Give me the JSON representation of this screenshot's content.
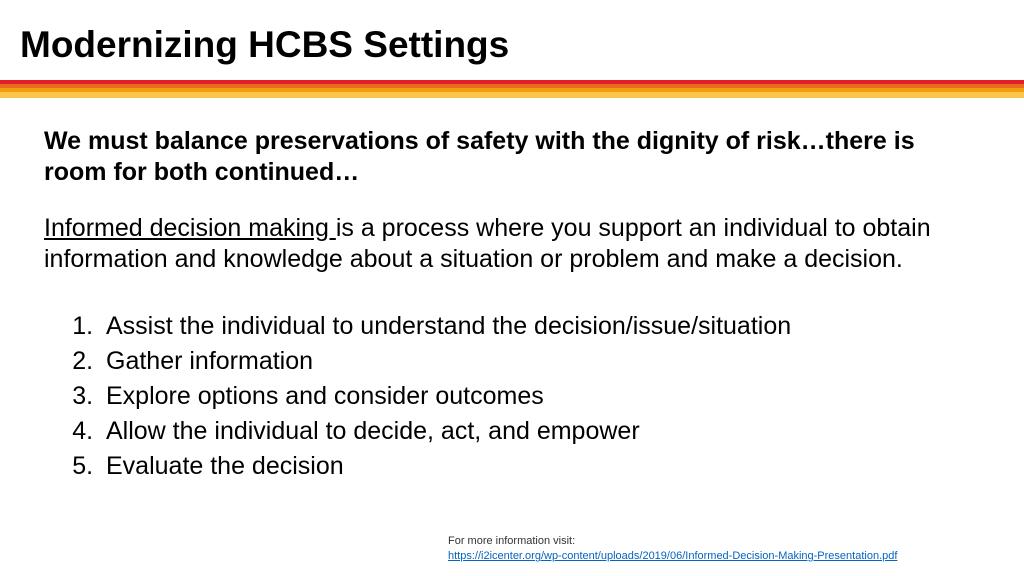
{
  "header": {
    "title": "Modernizing HCBS Settings"
  },
  "content": {
    "lead": "We must balance preservations of safety with the dignity of risk…there is room for both continued…",
    "intro_underlined": "Informed decision making ",
    "intro_rest": "is a process where you support an individual to obtain information and knowledge about a situation or problem and make a decision.",
    "steps": [
      "Assist the individual to understand the decision/issue/situation",
      "Gather information",
      "Explore options and consider outcomes",
      "Allow the individual to decide, act, and empower",
      "Evaluate the decision"
    ]
  },
  "footer": {
    "label": "For more information visit:",
    "link_text": "https://i2icenter.org/wp-content/uploads/2019/06/Informed-Decision-Making-Presentation.pdf"
  }
}
